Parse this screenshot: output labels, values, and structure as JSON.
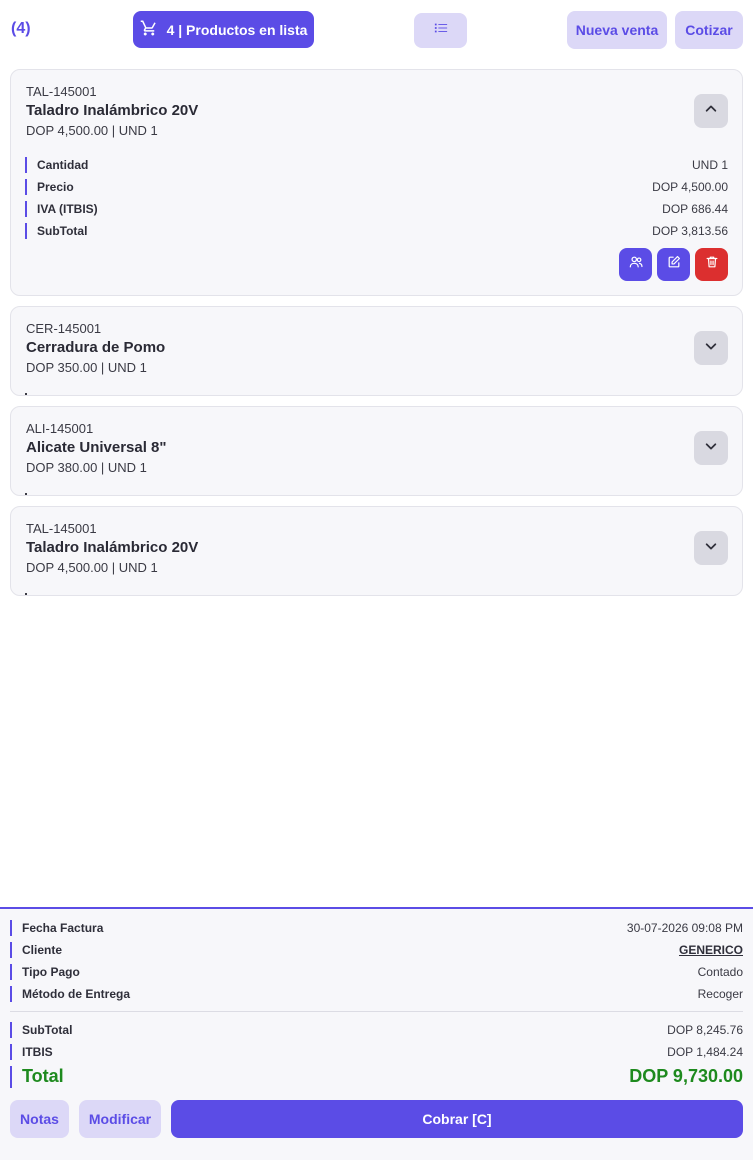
{
  "topbar": {
    "count_label": "(4)",
    "cart_label": "4 | Productos en lista",
    "new_sale_label": "Nueva venta",
    "quote_label": "Cotizar"
  },
  "products": [
    {
      "code": "TAL-145001",
      "name": "Taladro Inalámbrico 20V",
      "summary": "DOP 4,500.00 | UND 1",
      "expanded": true,
      "details": [
        {
          "label": "Cantidad",
          "value": "UND 1"
        },
        {
          "label": "Precio",
          "value": "DOP 4,500.00"
        },
        {
          "label": "IVA (ITBIS)",
          "value": "DOP 686.44"
        },
        {
          "label": "SubTotal",
          "value": "DOP 3,813.56"
        }
      ]
    },
    {
      "code": "CER-145001",
      "name": "Cerradura de Pomo",
      "summary": "DOP 350.00 | UND 1",
      "expanded": false
    },
    {
      "code": "ALI-145001",
      "name": "Alicate Universal 8\"",
      "summary": "DOP 380.00 | UND 1",
      "expanded": false
    },
    {
      "code": "TAL-145001",
      "name": "Taladro Inalámbrico 20V",
      "summary": "DOP 4,500.00 | UND 1",
      "expanded": false
    }
  ],
  "footer": {
    "info": [
      {
        "label": "Fecha Factura",
        "value": "30-07-2026 09:08 PM"
      },
      {
        "label": "Cliente",
        "value": "GENERICO"
      },
      {
        "label": "Tipo Pago",
        "value": "Contado"
      },
      {
        "label": "Método de Entrega",
        "value": "Recoger"
      }
    ],
    "totals": [
      {
        "label": "SubTotal",
        "value": "DOP 8,245.76"
      },
      {
        "label": "ITBIS",
        "value": "DOP 1,484.24"
      }
    ],
    "total_label": "Total",
    "total_value": "DOP 9,730.00",
    "notes_label": "Notas",
    "modify_label": "Modificar",
    "charge_label": "Cobrar [C]"
  },
  "colors": {
    "accent": "#5b4ce6",
    "accent_soft": "#dcd8f7",
    "danger": "#dc2f2f",
    "total_green": "#1e8a1e"
  },
  "icons": [
    "cart-icon",
    "list-icon",
    "chevron-up-icon",
    "chevron-down-icon",
    "users-icon",
    "edit-icon",
    "trash-icon"
  ]
}
